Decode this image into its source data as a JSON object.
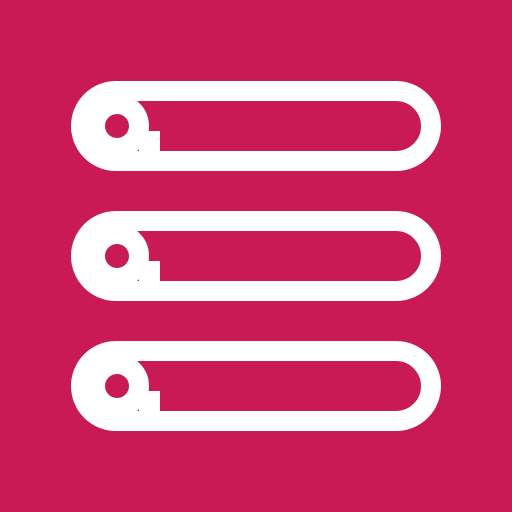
{
  "icon": {
    "name": "toggle-list-icon",
    "background_color": "#C91A56",
    "foreground_color": "#FFFFFF",
    "toggle_count": 3
  }
}
